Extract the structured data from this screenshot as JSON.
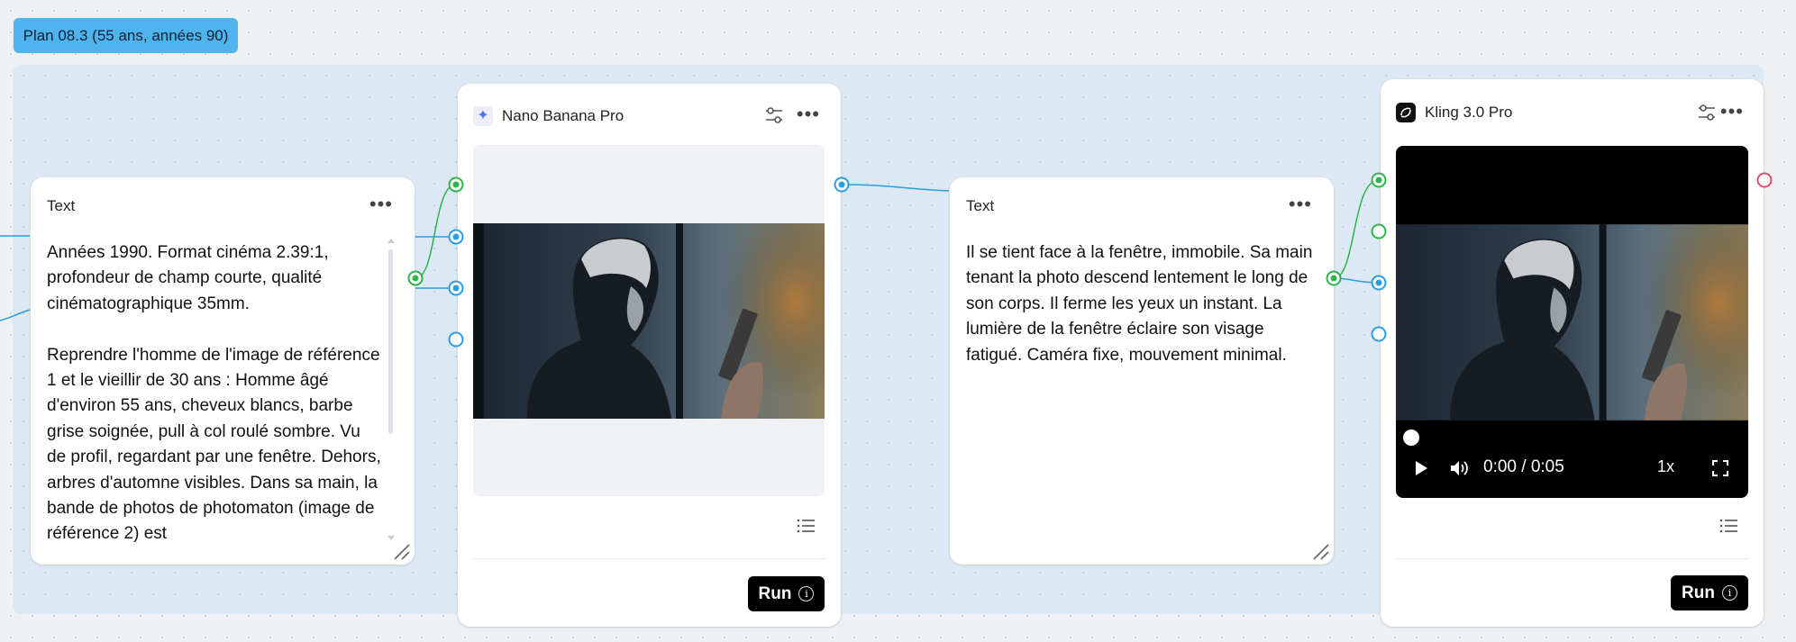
{
  "group": {
    "label": "Plan 08.3 (55 ans, années 90)"
  },
  "nodes": {
    "text1": {
      "title": "Text",
      "body": "Années 1990. Format cinéma 2.39:1, profondeur de champ courte, qualité cinématographique 35mm.\n\nReprendre l'homme de l'image de référence 1 et le vieillir de 30 ans : Homme âgé d'environ 55 ans, cheveux blancs, barbe grise soignée, pull à col roulé sombre. Vu de profil, regardant par une fenêtre. Dehors, arbres d'automne visibles. Dans sa main, la bande de photos de photomaton (image de référence 2) est"
    },
    "image_gen": {
      "title": "Nano Banana Pro",
      "icon": "sparkle-icon",
      "run_label": "Run"
    },
    "text2": {
      "title": "Text",
      "body": "Il se tient face à la fenêtre, immobile. Sa main tenant la photo descend lentement le long de son corps. Il ferme les yeux un instant. La lumière de la fenêtre éclaire son visage fatigué. Caméra fixe, mouvement minimal."
    },
    "video_gen": {
      "title": "Kling 3.0 Pro",
      "icon": "kling-logo-icon",
      "run_label": "Run",
      "time": "0:00 / 0:05",
      "speed": "1x",
      "progress": 0
    }
  },
  "colors": {
    "accent_blue": "#2a9ee0",
    "port_green": "#2fb34b",
    "port_red": "#e0506e",
    "group_label_bg": "#4fb3ee",
    "group_area_bg": "#dce9f4"
  }
}
